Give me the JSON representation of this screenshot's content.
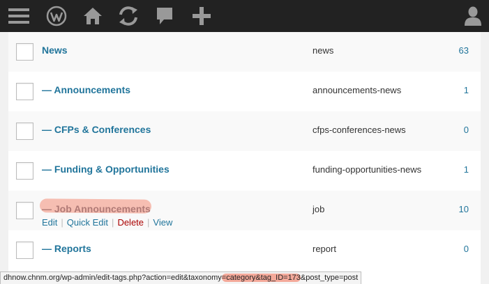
{
  "admin_bar": {
    "icons": [
      "menu-icon",
      "wordpress-icon",
      "home-icon",
      "refresh-icon",
      "comment-icon",
      "add-new-icon",
      "user-icon"
    ]
  },
  "categories": [
    {
      "name": "News",
      "slug": "news",
      "count": "63"
    },
    {
      "name": "— Announcements",
      "slug": "announcements-news",
      "count": "1"
    },
    {
      "name": "— CFPs & Conferences",
      "slug": "cfps-conferences-news",
      "count": "0"
    },
    {
      "name": "— Funding & Opportunities",
      "slug": "funding-opportunities-news",
      "count": "1"
    },
    {
      "name": "— Job Announcements",
      "slug": "job",
      "count": "10"
    },
    {
      "name": "— Reports",
      "slug": "report",
      "count": "0"
    }
  ],
  "row_actions": {
    "edit": "Edit",
    "quick_edit": "Quick Edit",
    "delete": "Delete",
    "view": "View",
    "separator": "|"
  },
  "status_bar": {
    "url_before": "dhnow.chnm.org/wp-admin/edit-tags.php?action=edit&taxonomy",
    "url_highlight": "=category&tag_ID=173",
    "url_after": "&post_type=post"
  },
  "colors": {
    "admin_bar": "#222222",
    "link": "#21759b",
    "delete": "#aa0000",
    "highlight": "#f4a99a"
  }
}
